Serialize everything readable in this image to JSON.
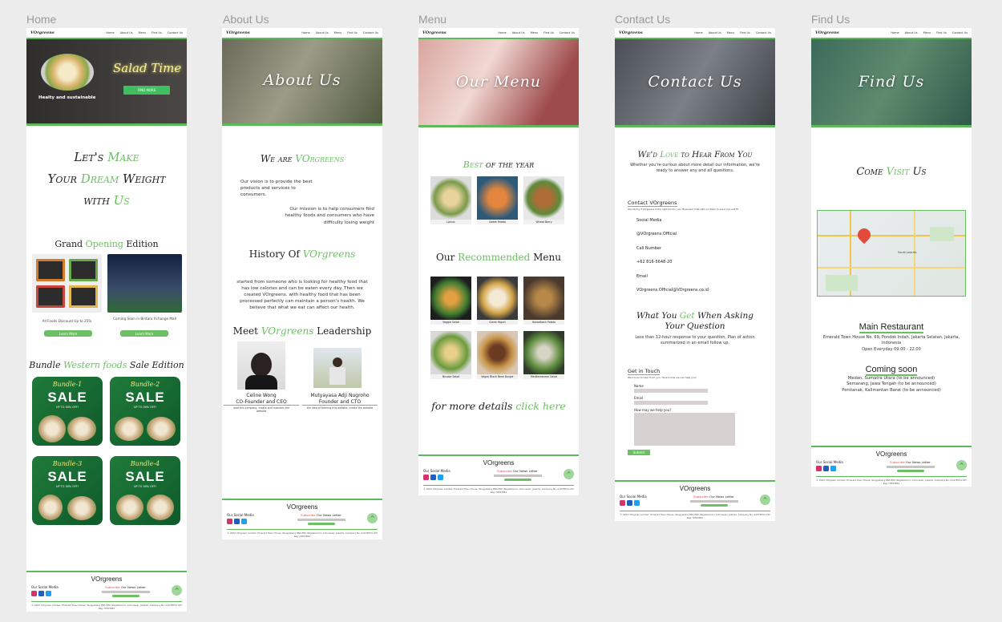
{
  "frames": {
    "home": "Home",
    "about": "About Us",
    "menu": "Menu",
    "contact": "Contact Us",
    "find": "Find Us"
  },
  "nav": {
    "logo": "VOrgreens",
    "links": [
      "Home",
      "About Us",
      "Menu",
      "Find Us",
      "Contact Us"
    ]
  },
  "home": {
    "hero_title": "Salad Time",
    "hero_tagline": "Healty and sustainable",
    "hero_button": "FIND MORE",
    "headline_1": "Let's ",
    "headline_1g": "Make",
    "headline_2": "Your ",
    "headline_2g": "Dream",
    "headline_2b": " Weight",
    "headline_3": "with ",
    "headline_3g": "Us",
    "grand_title_a": "Grand ",
    "grand_title_g": "Opening",
    "grand_title_b": " Edition",
    "promo1_caption": "All Foods Discount Up to 25%",
    "promo2_caption": "Coming Soon in Bintaro Xchange Mall",
    "learn_more": "Learn More",
    "bundle_title_a": "Bundle ",
    "bundle_title_g": "Western foods",
    "bundle_title_b": " Sale  Edition",
    "bundles": [
      {
        "name": "Bundle-1",
        "sale": "SALE",
        "off": "UP TO 30% OFF!"
      },
      {
        "name": "Bundle-2",
        "sale": "SALE",
        "off": "UP TO 30% OFF!"
      },
      {
        "name": "Bundle-3",
        "sale": "SALE",
        "off": "UP TO 30% OFF!"
      },
      {
        "name": "Bundle-4",
        "sale": "SALE",
        "off": "UP TO 30% OFF!"
      }
    ]
  },
  "about": {
    "hero_title": "About  Us",
    "we_are_a": "We are ",
    "we_are_g": "VOrgreens",
    "vision": "Our vision is to provide the best products and services to consumers.",
    "mission": "Our mission is to help consumers find healthy foods and consumers who have difficulty losing weight",
    "history_a": "History Of ",
    "history_g": "VOrgreens",
    "history_text": "started from someone who is looking for healthy food that has low calories and can be eaten every day. Then we created VOrgreens. with healthy food that has been processed perfectly can maintain a person's health. We believe that what we eat can affect our health.",
    "meet_a": "Meet ",
    "meet_g": "VOrgreens",
    "meet_b": " Leadership",
    "leader1_name": "Celine Wong",
    "leader1_role": "CO-Founder and CEO",
    "leader1_desc": "lead this company, create and maintain the website",
    "leader2_name": "Mutyayasa Adji Nugroho",
    "leader2_role": "Founder and CTO",
    "leader2_desc": "the idea of forming this website, create the website"
  },
  "menu": {
    "hero_title": "Our  Menu",
    "best_g": "Best",
    "best_b": " of the year",
    "best_items": [
      "Lpinus",
      "Sweet Potato",
      "Wheat Berry"
    ],
    "rec_a": "Our ",
    "rec_g": "Recommended",
    "rec_b": " Menu",
    "rec_items": [
      "Veggie Salad",
      "Greek Yogurt",
      "Hasselback Potato",
      "Nicoise Salad",
      "Vegan Black Bean Burger",
      "Mediterranean Salad"
    ],
    "details_a": "for more details  ",
    "details_g": "click here"
  },
  "contact": {
    "hero_title": "Contact  Us",
    "love_a": "We'd ",
    "love_g": "Love",
    "love_b": " to Hear From You",
    "intro": "Whether you're curious about more detail our information, we're ready to answer any and all questions.",
    "contact_title": "Contact VOrgreens",
    "contact_sub": "Wondering if VOrgreens is the right tool for your Business? Chat with our team to see it live and fit",
    "social_label": "Social Media",
    "social_value": "@VOrgreens.Official",
    "call_label": "Call Number",
    "call_value": "+62 816-5648-20",
    "email_label": "Email",
    "email_value": "VOrgreens.Official@VOrgreens.co.id",
    "ask_a": "What You ",
    "ask_g": "Get",
    "ask_b": " When Asking Your Question",
    "ask_text": "Less than 12-hour response to your question. Plan of action summarized in an email follow up.",
    "touch_title": "Get in Touch",
    "touch_sub": "We'd love to hear from you. Here's how we can help you!",
    "name_label": "Name",
    "email_field": "Email",
    "help_label": "How may we help you?",
    "submit": "Submit"
  },
  "find": {
    "hero_title": "Find  Us",
    "come_a": "Come ",
    "come_g": "Visit",
    "come_b": " Us",
    "map_label": "South Jakarta",
    "main_title": "Main Restaurant",
    "main_address": "Emerald Town House No. 69, Pondok Indah, Jakarta Selatan, Jakarta, Indonesia",
    "main_hours": "Open Everyday 09.00 - 22.00",
    "soon_title": "Coming soon",
    "soon_1": "Medan, Sumatra Utara (to be announced)",
    "soon_2": "Semarang, Jawa Tengah (to be announced)",
    "soon_3": "Pontianak, Kalimantan Barat (to be announced)"
  },
  "footer": {
    "brand": "VOrgreens",
    "social": "Our Social Media",
    "subscribe": "Subscribe",
    "newsletter": " Our News Letter",
    "copy": "© 2022 VOrgreen Limited. Emerald Town House, Tangyabang 88A P80 (Registered in Indonesia), Jakarta. Company No. 01078554 VAT Reg 72593861"
  },
  "colors": {
    "accent": "#6cbf63",
    "instagram": "#d6336c",
    "facebook": "#1f5fbf",
    "twitter": "#1da1f2"
  }
}
